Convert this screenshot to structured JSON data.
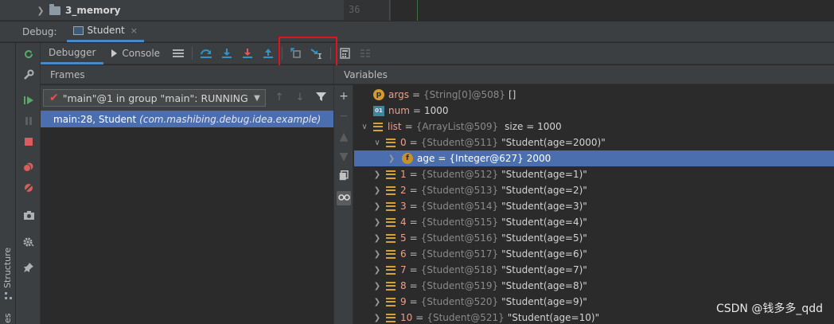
{
  "project_tree": {
    "folder_label": "3_memory",
    "line_number": "36"
  },
  "debug_header": {
    "label": "Debug:",
    "tab_name": "Student",
    "close_glyph": "×"
  },
  "sub_toolbar": {
    "debugger_tab": "Debugger",
    "console_tab": "Console"
  },
  "frames": {
    "title": "Frames",
    "thread_text": "\"main\"@1 in group \"main\": RUNNING",
    "frame_name": "main:28, Student",
    "frame_package": "(com.mashibing.debug.idea.example)"
  },
  "variables": {
    "title": "Variables",
    "rows": [
      {
        "name": "args",
        "type": "{String[0]@508}",
        "value": "[]"
      },
      {
        "name": "num",
        "value": "1000"
      },
      {
        "name": "list",
        "type": "{ArrayList@509}",
        "value": "size = 1000"
      },
      {
        "name": "0",
        "type": "{Student@511}",
        "value": "\"Student(age=2000)\""
      },
      {
        "name": "age",
        "type": "{Integer@627}",
        "value": "2000"
      },
      {
        "name": "1",
        "type": "{Student@512}",
        "value": "\"Student(age=1)\""
      },
      {
        "name": "2",
        "type": "{Student@513}",
        "value": "\"Student(age=2)\""
      },
      {
        "name": "3",
        "type": "{Student@514}",
        "value": "\"Student(age=3)\""
      },
      {
        "name": "4",
        "type": "{Student@515}",
        "value": "\"Student(age=4)\""
      },
      {
        "name": "5",
        "type": "{Student@516}",
        "value": "\"Student(age=5)\""
      },
      {
        "name": "6",
        "type": "{Student@517}",
        "value": "\"Student(age=6)\""
      },
      {
        "name": "7",
        "type": "{Student@518}",
        "value": "\"Student(age=7)\""
      },
      {
        "name": "8",
        "type": "{Student@519}",
        "value": "\"Student(age=8)\""
      },
      {
        "name": "9",
        "type": "{Student@520}",
        "value": "\"Student(age=9)\""
      },
      {
        "name": "10",
        "type": "{Student@521}",
        "value": "\"Student(age=10)\""
      }
    ]
  },
  "side": {
    "structure_label": "Structure",
    "cut_label": "es"
  },
  "watermark": "CSDN @钱多多_qdd",
  "colors": {
    "accent": "#4b6eaf",
    "highlight_box": "#e0141e",
    "background": "#2b2b2b",
    "panel": "#3c3f41"
  }
}
